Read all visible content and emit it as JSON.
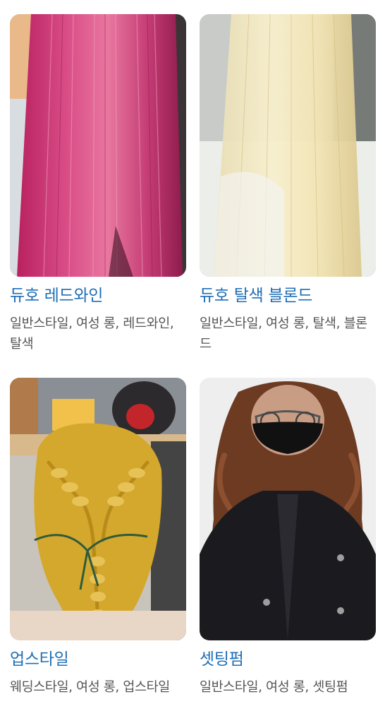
{
  "styles": [
    {
      "title": "듀호 레드와인",
      "tags": "일반스타일, 여성 롱, 레드와인, 탈색",
      "image": "photo of long straight magenta-red dyed hair seen from behind"
    },
    {
      "title": "듀호 탈색 블론드",
      "tags": "일반스타일, 여성 롱, 탈색, 블론드",
      "image": "photo of long straight platinum blonde hair seen from behind"
    },
    {
      "title": "업스타일",
      "tags": "웨딩스타일, 여성 롱, 업스타일",
      "image": "photo of golden-blonde braided updo with green ribbon on mannequin head"
    },
    {
      "title": "셋팅펌",
      "tags": "일반스타일, 여성 롱, 셋팅펌",
      "image": "photo of woman with long brown wavy setting-perm hair wearing black mask and jacket"
    }
  ]
}
